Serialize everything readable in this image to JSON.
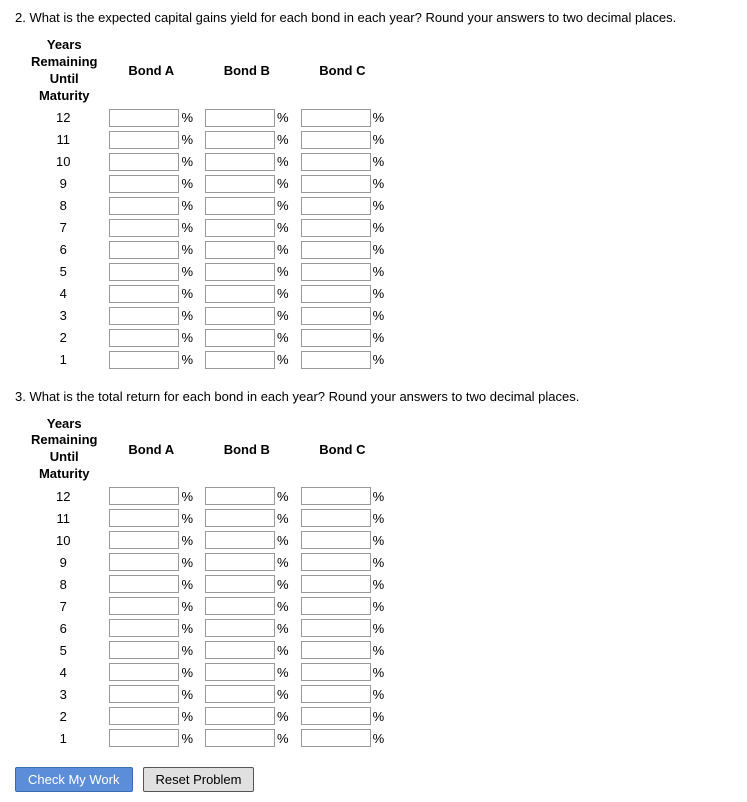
{
  "q2": {
    "text": "2.  What is the expected capital gains yield for each bond in each year? Round your answers to two decimal places.",
    "header": {
      "years_label": [
        "Years",
        "Remaining",
        "Until",
        "Maturity"
      ],
      "bond_a": "Bond A",
      "bond_b": "Bond B",
      "bond_c": "Bond C"
    },
    "years": [
      12,
      11,
      10,
      9,
      8,
      7,
      6,
      5,
      4,
      3,
      2,
      1
    ]
  },
  "q3": {
    "text": "3.  What is the total return for each bond in each year? Round your answers to two decimal places.",
    "header": {
      "years_label": [
        "Years",
        "Remaining",
        "Until",
        "Maturity"
      ],
      "bond_a": "Bond A",
      "bond_b": "Bond B",
      "bond_c": "Bond C"
    },
    "years": [
      12,
      11,
      10,
      9,
      8,
      7,
      6,
      5,
      4,
      3,
      2,
      1
    ]
  },
  "buttons": {
    "check": "Check My Work",
    "reset": "Reset Problem"
  }
}
